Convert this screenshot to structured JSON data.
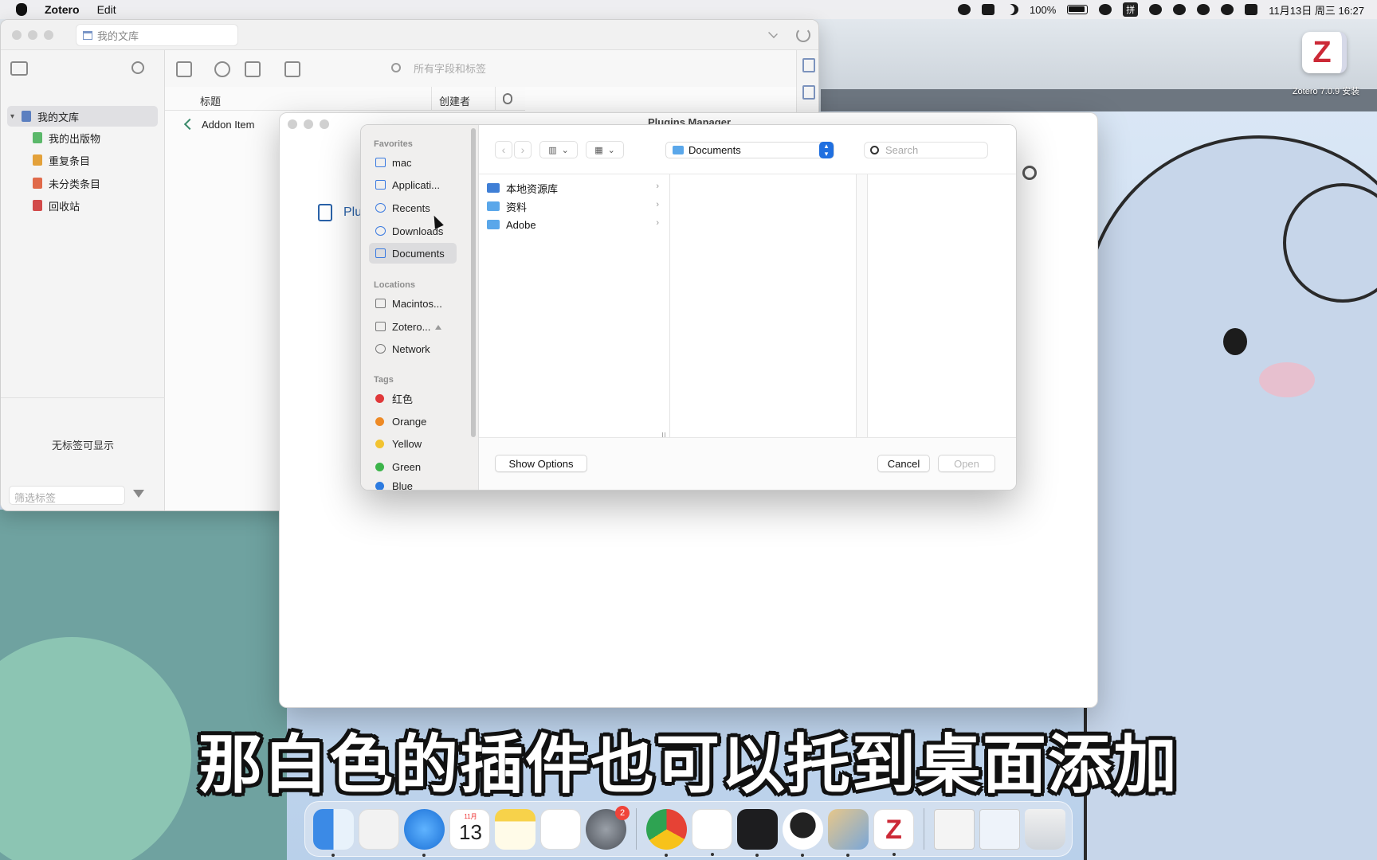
{
  "menubar": {
    "app_name": "Zotero",
    "menus": [
      "Edit"
    ],
    "battery": "100%",
    "ime": "拼",
    "datetime": "11月13日 周三  16:27"
  },
  "zotero": {
    "tab_title": "我的文库",
    "search_placeholder": "所有字段和标签",
    "tree": [
      {
        "label": "我的文库",
        "icon": "library-icon",
        "color": "#5b7fc0"
      },
      {
        "label": "我的出版物",
        "icon": "publications-icon",
        "color": "#5bb86a"
      },
      {
        "label": "重复条目",
        "icon": "duplicates-icon",
        "color": "#e3a13a"
      },
      {
        "label": "未分类条目",
        "icon": "unfiled-icon",
        "color": "#e06a4a"
      },
      {
        "label": "回收站",
        "icon": "trash-icon",
        "color": "#d24a4a"
      }
    ],
    "tags_empty": "无标签可显示",
    "tag_filter_placeholder": "筛选标签",
    "columns": {
      "title": "标题",
      "creator": "创建者"
    },
    "items": [
      {
        "title": "Addon Item"
      }
    ]
  },
  "plugins_manager": {
    "title": "Plugins Manager",
    "header_label": "Plu"
  },
  "open_panel": {
    "sections": {
      "favorites": "Favorites",
      "locations": "Locations",
      "tags": "Tags"
    },
    "favorites": [
      "mac",
      "Applicati...",
      "Recents",
      "Downloads",
      "Documents"
    ],
    "selected_favorite": "Documents",
    "locations": [
      "Macintos...",
      "Zotero...",
      "Network"
    ],
    "tags": [
      {
        "label": "红色",
        "color": "#e0383a"
      },
      {
        "label": "Orange",
        "color": "#ee8a25"
      },
      {
        "label": "Yellow",
        "color": "#f2c330"
      },
      {
        "label": "Green",
        "color": "#3cb44a"
      },
      {
        "label": "Blue",
        "color": "#2d7be0"
      }
    ],
    "location_popup": "Documents",
    "search_placeholder": "Search",
    "folders": [
      "本地资源库",
      "资料",
      "Adobe"
    ],
    "show_options": "Show Options",
    "cancel": "Cancel",
    "open": "Open"
  },
  "installer_badge": {
    "letter": "Z",
    "label": "Zotero 7.0.9 安装"
  },
  "subtitle": "那白色的插件也可以托到桌面添加",
  "dock": {
    "calendar_month": "11月",
    "calendar_day": "13",
    "settings_badge": "2",
    "apps": [
      "finder-icon",
      "launchpad-icon",
      "safari-icon",
      "calendar-icon",
      "notes-icon",
      "reminders-icon",
      "settings-icon",
      "chrome-icon",
      "photos-icon",
      "recorder-icon",
      "qq-icon",
      "preview-icon",
      "zotero-icon",
      "doc-thumb-icon",
      "window-thumb-icon",
      "trash-icon"
    ]
  }
}
